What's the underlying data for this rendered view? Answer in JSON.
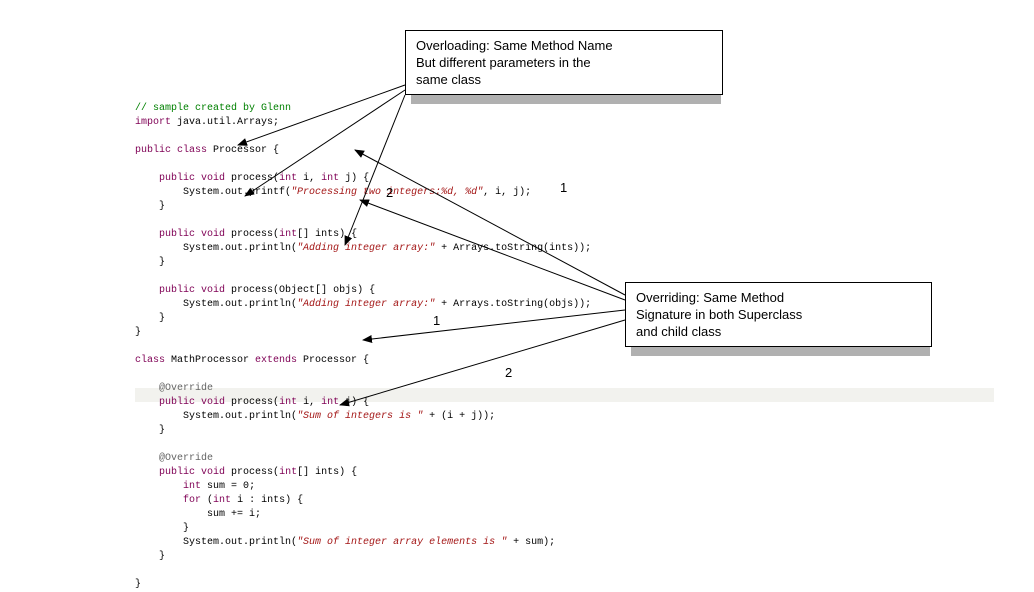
{
  "callouts": {
    "overloading": {
      "line1": "Overloading: Same Method Name",
      "line2": "But different parameters in the",
      "line3": "same class"
    },
    "overriding": {
      "line1": "Overriding: Same Method",
      "line2": "Signature in both Superclass",
      "line3": "and child class"
    }
  },
  "labels": {
    "ov1_1": "1",
    "ov1_2": "2",
    "ov2_1": "1",
    "ov2_2": "2"
  },
  "code": {
    "l01a": "// sample created by Glenn",
    "l02a": "import",
    "l02b": " java.util.Arrays;",
    "l04a": "public",
    "l04b": " class",
    "l04c": " Processor {",
    "l06a": "public",
    "l06b": " void",
    "l06c": " process(",
    "l06d": "int",
    "l06e": " i, ",
    "l06f": "int",
    "l06g": " j) {",
    "l07a": "System.out.printf(",
    "l07b": "\"Processing two integers:%d, %d\"",
    "l07c": ", i, j);",
    "l08a": "}",
    "l10a": "public",
    "l10b": " void",
    "l10c": " process(",
    "l10d": "int",
    "l10e": "[] ints) {",
    "l11a": "System.out.println(",
    "l11b": "\"Adding integer array:\"",
    "l11c": " + Arrays.toString(ints));",
    "l12a": "}",
    "l14a": "public",
    "l14b": " void",
    "l14c": " process(Object[] objs) {",
    "l15a": "System.out.println(",
    "l15b": "\"Adding integer array:\"",
    "l15c": " + Arrays.toString(objs));",
    "l16a": "}",
    "l17a": "}",
    "l19a": "class",
    "l19b": " MathProcessor ",
    "l19c": "extends",
    "l19d": " Processor {",
    "l21a": "@Override",
    "l22a": "public",
    "l22b": " void",
    "l22c": " process(",
    "l22d": "int",
    "l22e": " i, ",
    "l22f": "int",
    "l22g": " j) {",
    "l23a": "System.out.println(",
    "l23b": "\"Sum of integers is \"",
    "l23c": " + (i + j));",
    "l24a": "}",
    "l26a": "@Override",
    "l27a": "public",
    "l27b": " void",
    "l27c": " process(",
    "l27d": "int",
    "l27e": "[] ints) {",
    "l28a": "int",
    "l28b": " sum = ",
    "l28c": "0",
    "l28d": ";",
    "l29a": "for",
    "l29b": " (",
    "l29c": "int",
    "l29d": " i : ints) {",
    "l30a": "sum += i;",
    "l31a": "}",
    "l32a": "System.out.println(",
    "l32b": "\"Sum of integer array elements is \"",
    "l32c": " + sum);",
    "l33a": "}",
    "l35a": "}"
  }
}
